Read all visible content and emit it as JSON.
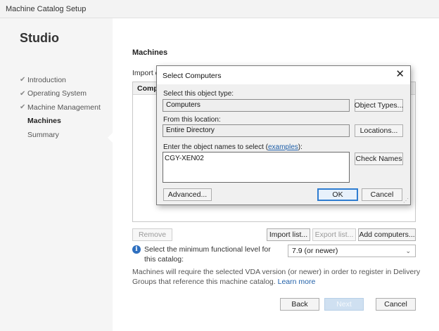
{
  "window": {
    "title": "Machine Catalog Setup"
  },
  "sidebar": {
    "app_name": "Studio",
    "steps": [
      {
        "label": "Introduction",
        "state": "completed"
      },
      {
        "label": "Operating System",
        "state": "completed"
      },
      {
        "label": "Machine Management",
        "state": "completed"
      },
      {
        "label": "Machines",
        "state": "active"
      },
      {
        "label": "Summary",
        "state": "pending"
      }
    ],
    "check_glyph": "✔"
  },
  "main": {
    "section_title": "Machines",
    "import_text": "Import c",
    "grid_header": "Compu",
    "buttons": {
      "remove": "Remove",
      "import_list": "Import list...",
      "export_list": "Export list...",
      "add_computers": "Add computers..."
    },
    "functional_level_label": "Select the minimum functional level for this catalog:",
    "functional_level_value": "7.9 (or newer)",
    "notice_text": "Machines will require the selected VDA version (or newer) in order to register in Delivery Groups that reference this machine catalog.",
    "learn_more": "Learn more",
    "footer": {
      "back": "Back",
      "next": "Next",
      "cancel": "Cancel"
    }
  },
  "dialog": {
    "title": "Select Computers",
    "close_glyph": "✕",
    "object_type_label": "Select this object type:",
    "object_type_value": "Computers",
    "object_types_button": "Object Types...",
    "location_label": "From this location:",
    "location_value": "Entire Directory",
    "locations_button": "Locations...",
    "names_label_prefix": "Enter the object names to select (",
    "names_label_link": "examples",
    "names_label_suffix": "):",
    "names_value": "CGY-XEN02",
    "check_names_button": "Check Names",
    "advanced_button": "Advanced...",
    "ok_button": "OK",
    "cancel_button": "Cancel"
  },
  "colors": {
    "accent": "#2e6fbf",
    "link": "#1f5fa8",
    "sidebar_bg": "#f5f5f5"
  },
  "icons": {
    "info": "info-icon",
    "close": "close-icon",
    "checkmark": "checkmark-icon",
    "dropdown": "chevron-down-icon"
  }
}
